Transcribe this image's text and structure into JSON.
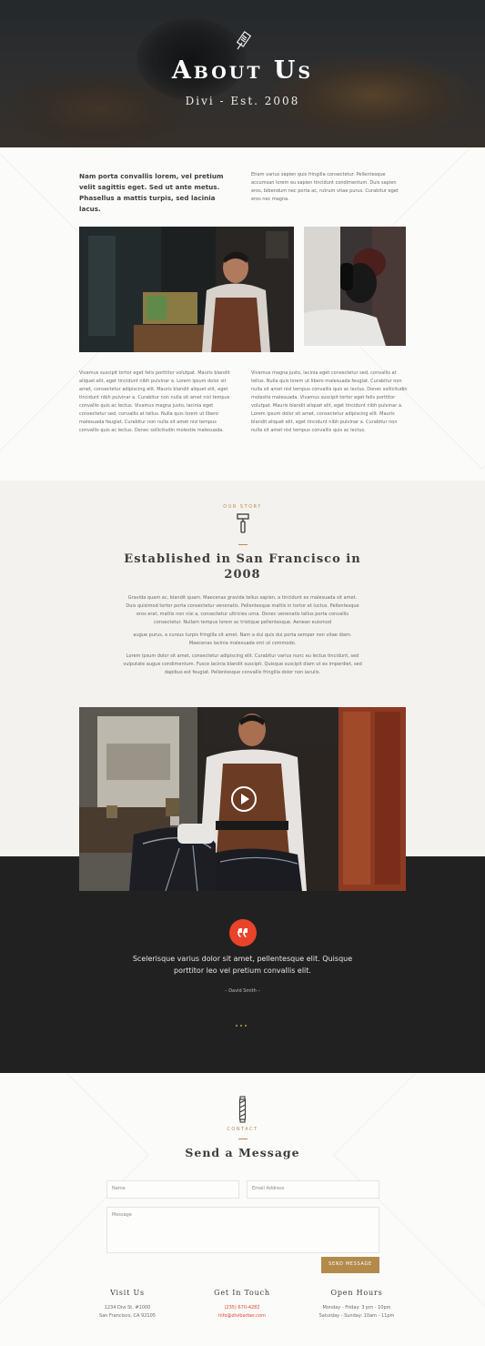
{
  "hero": {
    "title": "About Us",
    "subtitle": "Divi - Est. 2008"
  },
  "intro": {
    "lead": "Nam porta convallis lorem, vel pretium velit sagittis eget. Sed ut ante metus. Phasellus a mattis turpis, sed lacinia lacus.",
    "side": "Etiam varius sapien quis fringilla consectetur. Pellentesque accumsan lorem eu sapien tincidunt condimentum. Duis sapien eros, bibendum nec porta ac, rutrum vitae purus. Curabitur eget eros nec magna.",
    "col_left": "Vivamus suscipit tortor eget felis porttitor volutpat. Mauris blandit aliquet elit, eget tincidunt nibh pulvinar a. Lorem ipsum dolor sit amet, consectetur adipiscing elit. Mauris blandit aliquet elit, eget tincidunt nibh pulvinar a. Curabitur non nulla sit amet nisl tempus convallis quis ac lectus. Vivamus magna justo, lacinia eget consectetur sed, convallis at tellus. Nulla quis lorem ut libero malesuada feugiat. Curabitur non nulla sit amet nisl tempus convallis quis ac lectus. Donec sollicitudin molestie malesuada.",
    "col_right": "Vivamus magna justo, lacinia eget consectetur sed, convallis at tellus. Nulla quis lorem ut libero malesuada feugiat. Curabitur non nulla sit amet nisl tempus convallis quis ac lectus. Donec sollicitudin molestie malesuada. Vivamus suscipit tortor eget felis porttitor volutpat. Mauris blandit aliquet elit, eget tincidunt nibh pulvinar a. Lorem ipsum dolor sit amet, consectetur adipiscing elit. Mauris blandit aliquet elit, eget tincidunt nibh pulvinar a. Curabitur non nulla sit amet nisl tempus convallis quis ac lectus."
  },
  "story": {
    "label": "OUR STORY",
    "title": "Established in San Francisco in 2008",
    "paragraphs": [
      "Gravida quam ac, blandit quam. Maecenas gravida tellus sapien, a tincidunt ex malesuada sit amet. Duis quisimod tortor porta consectetur venenatis. Pellentesque mattis in tortor et luctus. Pellentesque eros erat, mattis non nisi a, consectetur ultricies urna. Donec venenatis tellus porta convallis consectetur. Nullam tempus lorem ac tristique pellentesque. Aenean euismod",
      "augue purus, a cursus turpis fringilla sit amet. Nam a dui quis dui porta semper non vitae diam. Maecenas lacinia malesuada orci ut commodo.",
      "Lorem ipsum dolor sit amet, consectetur adipiscing elit. Curabitur varius nunc eu lectus tincidunt, sed vulputate augue condimentum. Fusce lacinia blandit suscipit. Quisque suscipit diam ut ex imperdiet, sed dapibus est feugiat. Pellentesque convallis fringilla dolor non iaculis."
    ]
  },
  "testimonial": {
    "quote": "Scelerisque varius dolor sit amet, pellentesque elit. Quisque porttitor leo vel pretium convallis elit.",
    "author": "– David Smith –"
  },
  "contact": {
    "label": "CONTACT",
    "title": "Send a Message",
    "name_placeholder": "Name",
    "email_placeholder": "Email Address",
    "message_placeholder": "Message",
    "send_label": "SEND MESSAGE"
  },
  "info": {
    "visit": {
      "title": "Visit Us",
      "line1": "1234 Divi St. #1000",
      "line2": "San Francisco, CA 92105"
    },
    "touch": {
      "title": "Get In Touch",
      "line1": "(235) 670-4282",
      "line2": "info@divibarber.com"
    },
    "hours": {
      "title": "Open Hours",
      "line1": "Monday - Friday: 3 pm - 10pm",
      "line2": "Saturday - Sunday: 10am - 11pm"
    }
  },
  "colors": {
    "accent_gold": "#b28b4c",
    "accent_red": "#e8432b",
    "dark_section": "#212121"
  },
  "icons": {
    "hero": "comb-icon",
    "story": "razor-icon",
    "contact": "barber-pole-icon",
    "quote": "quote-icon",
    "video": "play-icon"
  }
}
